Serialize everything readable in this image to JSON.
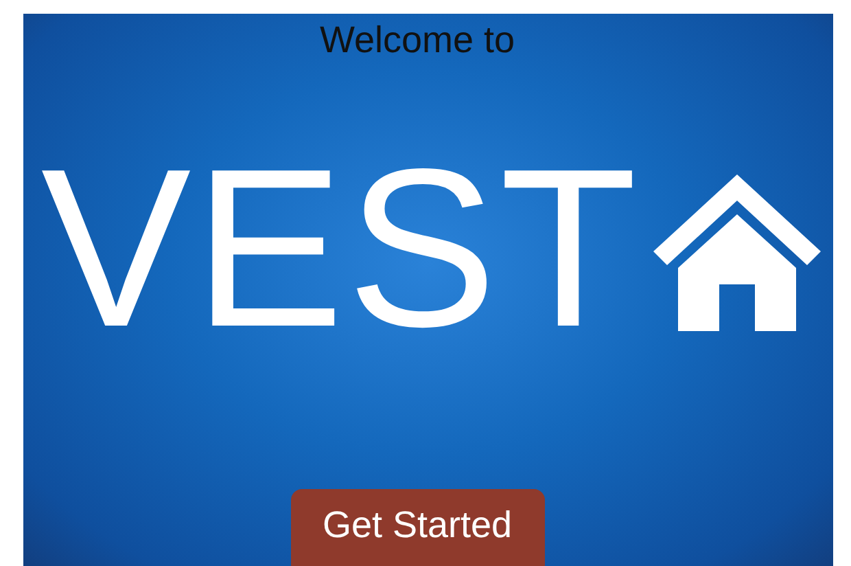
{
  "greeting": "Welcome to",
  "logo": {
    "text": "VEST"
  },
  "button": {
    "label": "Get Started"
  }
}
